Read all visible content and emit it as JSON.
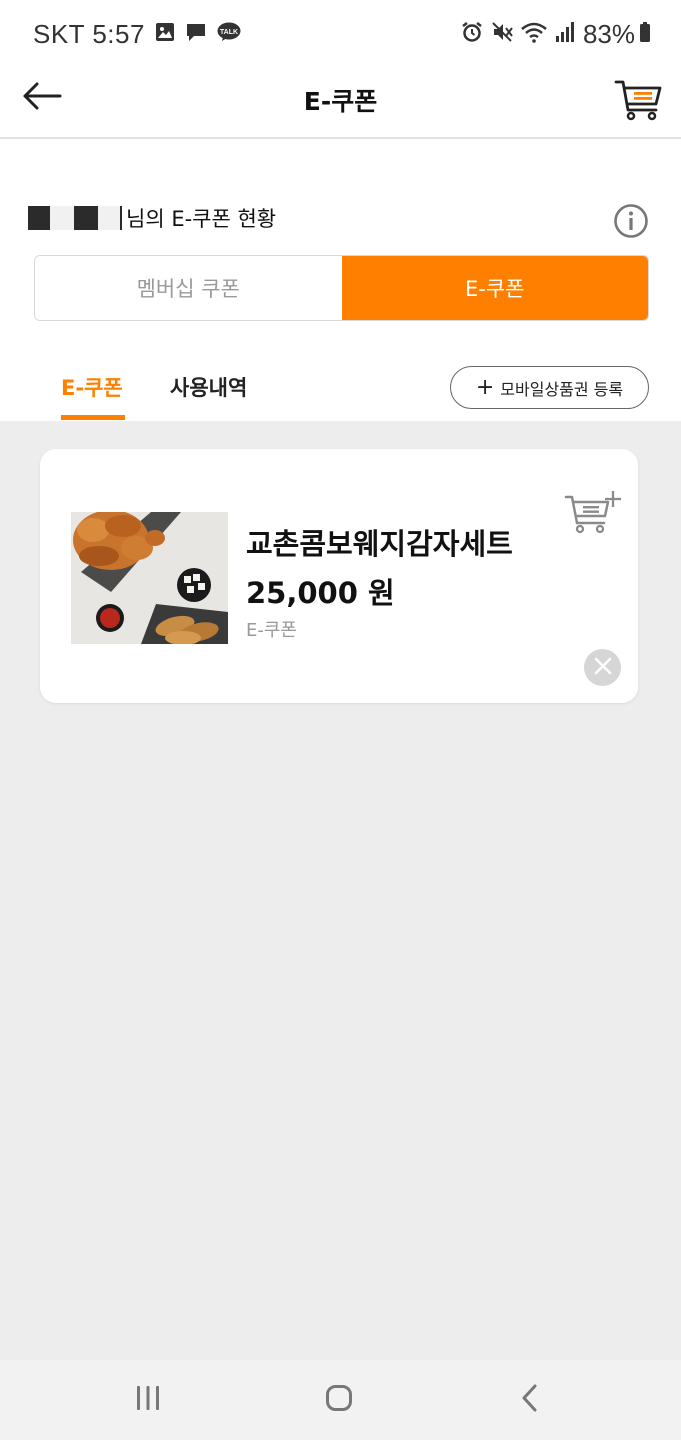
{
  "status_bar": {
    "carrier_time": "SKT 5:57",
    "battery": "83%",
    "left_icons": [
      "gallery-icon",
      "message-icon",
      "kakaotalk-icon"
    ],
    "right_icons": [
      "alarm-icon",
      "mute-icon",
      "wifi-icon",
      "signal-icon",
      "battery-icon"
    ],
    "kakao_label": "TALK"
  },
  "header": {
    "title": "E-쿠폰",
    "back_icon": "arrow-left-icon",
    "cart_icon": "cart-icon"
  },
  "user": {
    "suffix": "님의 E-쿠폰 현황"
  },
  "segment": {
    "membership_label": "멤버십 쿠폰",
    "ecoupon_label": "E-쿠폰",
    "active": "E-쿠폰"
  },
  "tabs": {
    "items": [
      {
        "label": "E-쿠폰",
        "active": true
      },
      {
        "label": "사용내역",
        "active": false
      }
    ],
    "register_label": "모바일상품권 등록"
  },
  "coupon": {
    "name": "교촌콤보웨지감자세트",
    "price": "25,000 원",
    "type": "E-쿠폰"
  },
  "colors": {
    "accent": "#ff8000",
    "background": "#ededed"
  }
}
